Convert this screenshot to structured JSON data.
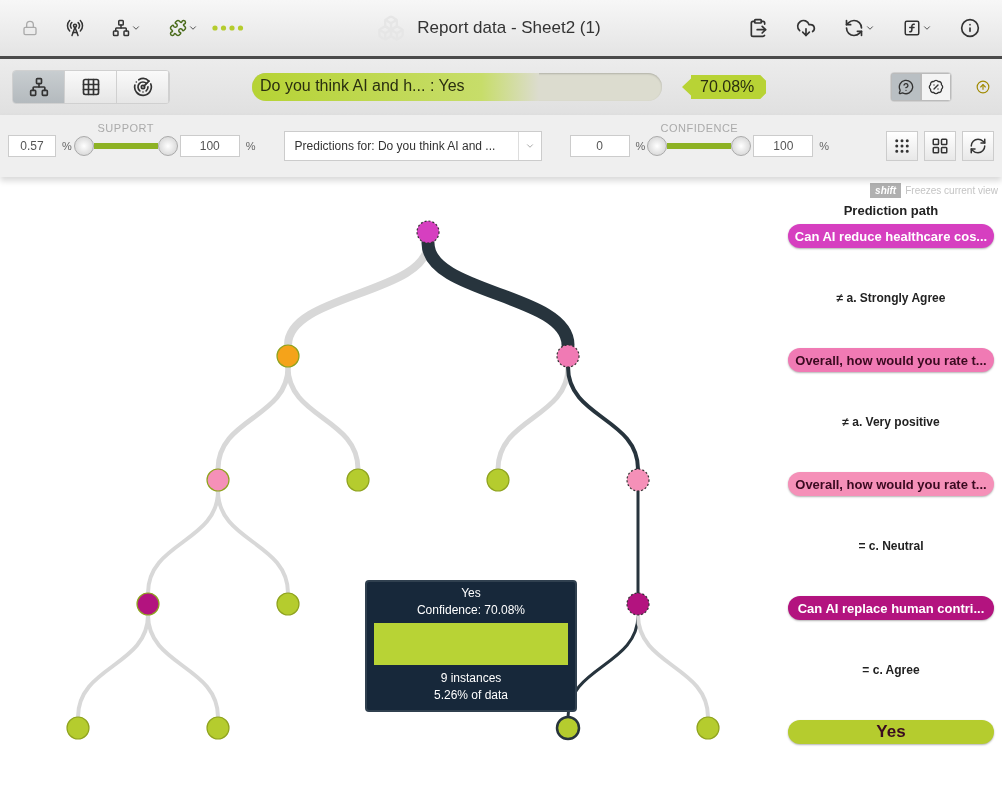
{
  "toolbar": {
    "title": "Report data - Sheet2 (1)"
  },
  "view_buttons": [
    {
      "selected": true
    },
    {
      "selected": false
    },
    {
      "selected": false
    }
  ],
  "prediction": {
    "label": "Do you think AI and h...  : Yes",
    "level": 0.7008,
    "confidence": "70.08%"
  },
  "mode_buttons": [
    {
      "selected": true
    },
    {
      "selected": false
    }
  ],
  "support": {
    "label": "SUPPORT",
    "min": "0.57",
    "max": "100",
    "unit": "%",
    "level": 1
  },
  "objective_select": {
    "value": "Predictions for: Do you think AI and ..."
  },
  "confidence_filter": {
    "label": "CONFIDENCE",
    "min": "0",
    "max": "100",
    "unit": "%",
    "level": 1
  },
  "hint": {
    "key": "shift",
    "text": "Freezes current view"
  },
  "tree": {
    "color": "#d63fc0",
    "on_path": true,
    "selected": false,
    "children": [
      {
        "color": "#f5a31a",
        "on_path": false,
        "selected": false,
        "children": [
          {
            "color": "#f590b8",
            "on_path": false,
            "selected": false,
            "children": [
              {
                "color": "#b3137f",
                "on_path": false,
                "selected": false,
                "children": [
                  {
                    "color": "#b5cc2e",
                    "on_path": false,
                    "selected": false
                  },
                  {
                    "color": "#b5cc2e",
                    "on_path": false,
                    "selected": false
                  }
                ]
              },
              {
                "color": "#b5cc2e",
                "on_path": false,
                "selected": false
              }
            ]
          },
          {
            "color": "#b5cc2e",
            "on_path": false,
            "selected": false
          }
        ]
      },
      {
        "color": "#f07ab4",
        "on_path": true,
        "selected": false,
        "children": [
          {
            "color": "#b5cc2e",
            "on_path": false,
            "selected": false
          },
          {
            "color": "#f590b8",
            "on_path": true,
            "selected": false,
            "children": [
              {
                "color": "#b3137f",
                "on_path": true,
                "selected": false,
                "children": [
                  {
                    "color": "#b5cc2e",
                    "on_path": true,
                    "selected": true
                  },
                  {
                    "color": "#b5cc2e",
                    "on_path": false,
                    "selected": false
                  }
                ]
              }
            ]
          }
        ]
      }
    ]
  },
  "tooltip": {
    "title": "Yes",
    "confidence": "Confidence: 70.08%",
    "instances": "9 instances",
    "share": "5.26% of data"
  },
  "prediction_path": {
    "title": "Prediction path",
    "steps": [
      {
        "kind": "field",
        "text": "Can AI reduce healthcare cos...",
        "color": "#d63fc0"
      },
      {
        "kind": "condition",
        "text": "≠ a. Strongly Agree"
      },
      {
        "kind": "field",
        "text": "Overall, how would you rate t...",
        "color": "#f07ab4"
      },
      {
        "kind": "condition",
        "text": "≠ a. Very positive"
      },
      {
        "kind": "field",
        "text": "Overall, how would you rate t...",
        "color": "#f590b8"
      },
      {
        "kind": "condition",
        "text": "= c. Neutral"
      },
      {
        "kind": "field",
        "text": "Can AI replace human contri...",
        "color": "#b3137f"
      },
      {
        "kind": "condition",
        "text": "= c. Agree"
      },
      {
        "kind": "result",
        "text": "Yes",
        "color": "#b5cc2e"
      }
    ]
  }
}
